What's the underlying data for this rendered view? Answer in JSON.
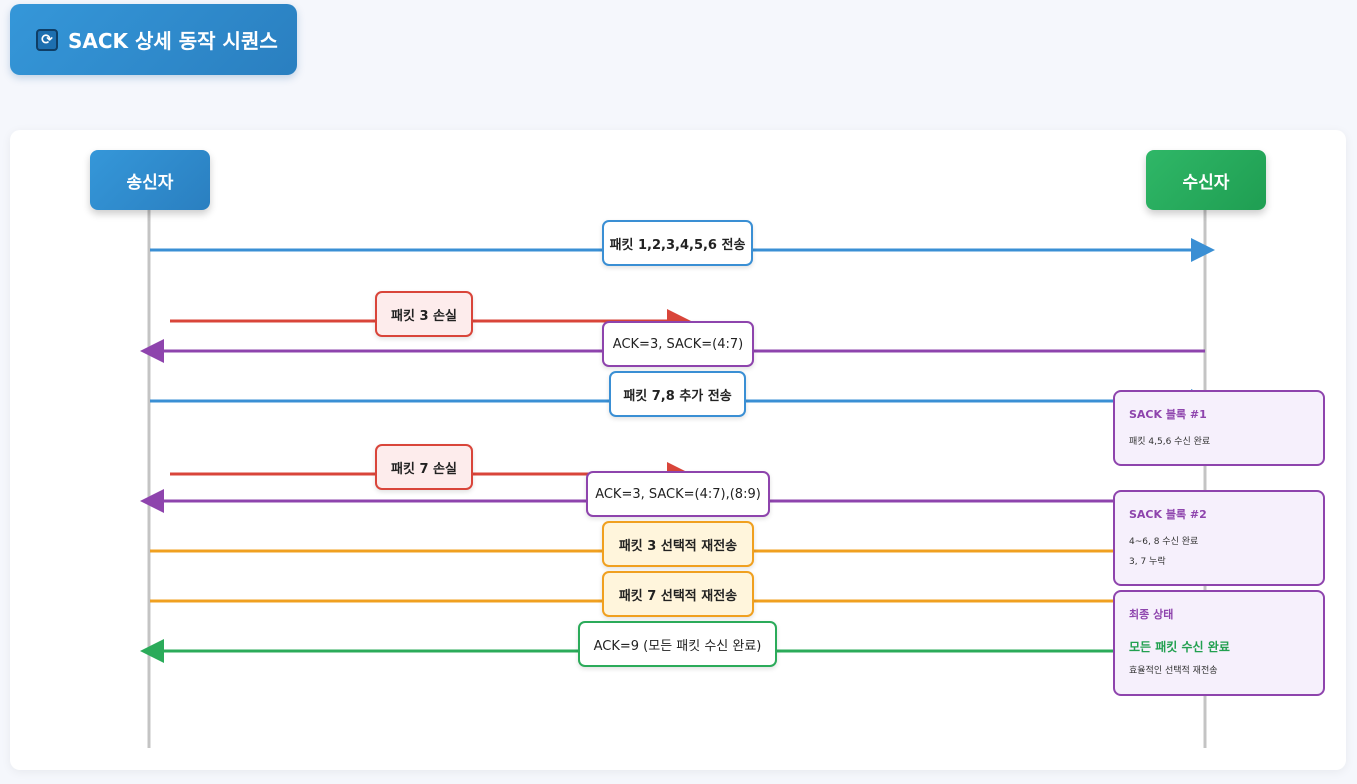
{
  "header": {
    "title": "SACK 상세 동작 시퀀스",
    "icon": "refresh-icon"
  },
  "actors": {
    "sender": "송신자",
    "receiver": "수신자"
  },
  "messages": {
    "m1": "패킷 1,2,3,4,5,6 전송",
    "loss1": "패킷 3 손실",
    "ack1": "ACK=3, SACK=(4:7)",
    "m2": "패킷 7,8 추가 전송",
    "loss2": "패킷 7 손실",
    "ack2": "ACK=3, SACK=(4:7),(8:9)",
    "retx3": "패킷 3 선택적 재전송",
    "retx7": "패킷 7 선택적 재전송",
    "ack_final": "ACK=9 (모든 패킷 수신 완료)"
  },
  "notes": {
    "block1": {
      "title": "SACK 블록 #1",
      "line1": "패킷 4,5,6 수신 완료"
    },
    "block2": {
      "title": "SACK 블록 #2",
      "line1": "4~6, 8 수신 완료",
      "line2": "3, 7 누락"
    },
    "final": {
      "title": "최종 상태",
      "highlight": "모든 패킷 수신 완료",
      "line1": "효율적인 선택적 재전송"
    }
  },
  "colors": {
    "data": "#3a8fd4",
    "ack": "#8e44ad",
    "loss": "#d9453a",
    "retransmit": "#f0a020",
    "final_ack": "#2bab5a"
  }
}
